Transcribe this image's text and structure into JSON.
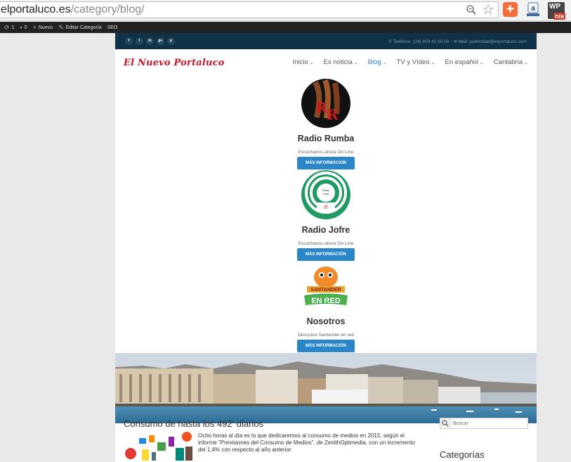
{
  "browser": {
    "url_host": "elportaluco.es",
    "url_path": "/category/blog/"
  },
  "adminbar": {
    "items": [
      {
        "label": "1"
      },
      {
        "label": "0"
      },
      {
        "label": "Nuevo"
      },
      {
        "label": "Editar Categoría"
      },
      {
        "label": "SEO"
      }
    ]
  },
  "topbar": {
    "socials": [
      "f",
      "t",
      "in",
      "g+",
      "p"
    ],
    "phone": "Teléfono: (34) 609 42 60 09",
    "mail": "Mail: publicidad@elportaluco.com"
  },
  "logo": "El Nuevo Portaluco",
  "menu": [
    {
      "label": "Inicio"
    },
    {
      "label": "Es noticia"
    },
    {
      "label": "Blog"
    },
    {
      "label": "TV y Vídeo"
    },
    {
      "label": "En español"
    },
    {
      "label": "Cantabria"
    }
  ],
  "stations": [
    {
      "title": "Radio Rumba",
      "subtitle": "Escúchanos ahora On Line",
      "button": "MÁS INFORMACIÓN"
    },
    {
      "title": "Radio Jofre",
      "subtitle": "Escúchanos ahora On Line",
      "button": "MÁS INFORMACIÓN"
    },
    {
      "title": "Nosotros",
      "subtitle": "Descubre Santander en red",
      "button": "MÁS INFORMACIÓN"
    }
  ],
  "post": {
    "title": "Consumo de hasta los 492' diarios",
    "excerpt": "Ocho horas al día es lo que dedicaremos al consumo de medios en 2015, según el informe \"Previsiones del Consumo de Medios\", de ZenithOptimedia, con un incremento del 1,4% con respecto al año anterior."
  },
  "sidebar": {
    "search_placeholder": "Buscar",
    "categories_title": "Categorías"
  },
  "colors": {
    "topbar": "#0e3348",
    "accent": "#2a86c6",
    "logo": "#c0182b"
  }
}
